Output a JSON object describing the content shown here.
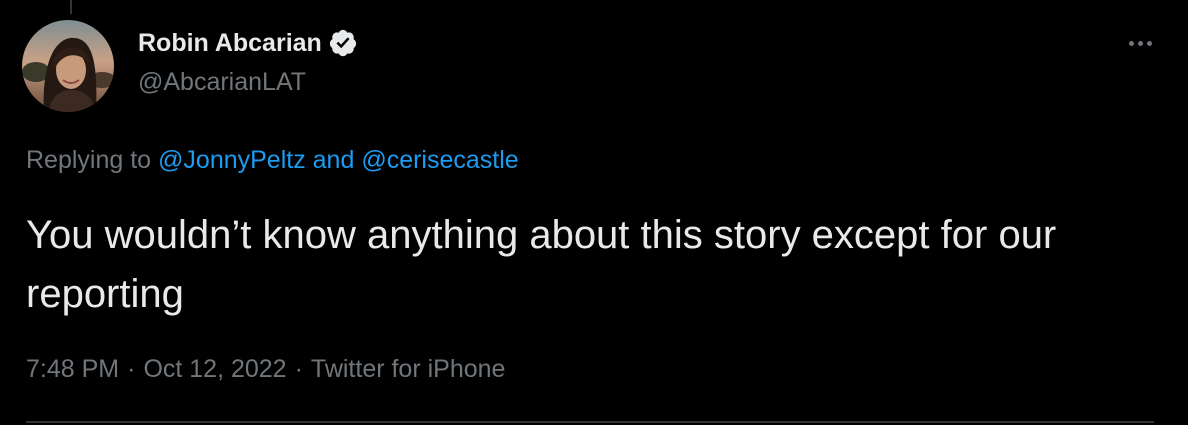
{
  "tweet": {
    "author": {
      "name": "Robin Abcarian",
      "handle": "@AbcarianLAT",
      "verified": true
    },
    "more_icon": "more-horizontal-icon",
    "replying": {
      "prefix": "Replying to",
      "mention_1": "@JonnyPeltz",
      "conjunction": "and",
      "mention_2": "@cerisecastle"
    },
    "text": "You wouldn’t know anything about this story except for our reporting",
    "meta": {
      "time": "7:48 PM",
      "separator": "·",
      "date": "Oct 12, 2022",
      "source": "Twitter for iPhone"
    }
  },
  "colors": {
    "background": "#000000",
    "primary_text": "#e7e9ea",
    "secondary_text": "#71767b",
    "link": "#1d9bf0"
  }
}
